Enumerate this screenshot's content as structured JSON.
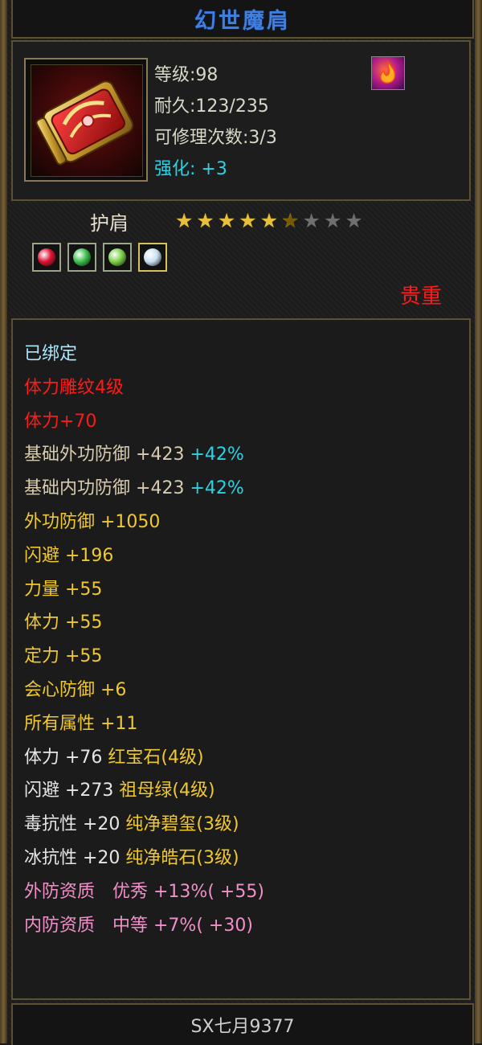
{
  "item": {
    "name": "幻世魔肩",
    "level": "等级:98",
    "durability": "耐久:123/235",
    "repair_count": "可修理次数:3/3",
    "enhance_label": "强化:",
    "enhance_value": "+3"
  },
  "equip": {
    "slot": "护肩",
    "stars_total": 9,
    "stars_filled": 5.5,
    "gems": [
      {
        "icon": "ruby-gem-icon",
        "color": "#e01030"
      },
      {
        "icon": "emerald-gem-icon",
        "color": "#3bc04a"
      },
      {
        "icon": "emerald-gem-icon",
        "color": "#7ad046"
      },
      {
        "icon": "diamond-gem-icon",
        "color": "#c8e0f0"
      }
    ],
    "quality": "贵重"
  },
  "attributes": {
    "bound": "已绑定",
    "carve_name": "体力雕纹4级",
    "carve_bonus": "体力+70",
    "base_ext_def_label": "基础外功防御",
    "base_ext_def_value": "+423",
    "base_ext_def_pct": "+42%",
    "base_int_def_label": "基础内功防御",
    "base_int_def_value": "+423",
    "base_int_def_pct": "+42%",
    "ext_def": "外功防御 +1050",
    "dodge": "闪避 +196",
    "strength": "力量 +55",
    "stamina": "体力 +55",
    "focus": "定力 +55",
    "crit_def": "会心防御 +6",
    "all_attr": "所有属性 +11",
    "gem1_stat": "体力 +76",
    "gem1_name": "红宝石(4级)",
    "gem2_stat": "闪避 +273",
    "gem2_name": "祖母绿(4级)",
    "gem3_stat": "毒抗性 +20",
    "gem3_name": "纯净碧玺(3级)",
    "gem4_stat": "冰抗性 +20",
    "gem4_name": "纯净皓石(3级)",
    "ext_aptitude": "外防资质　优秀 +13%( +55)",
    "int_aptitude": "内防资质　中等 +7%( +30)"
  },
  "owner": "SX七月9377",
  "colors": {
    "title": "#3f7fe0",
    "quality": "#ff1a1a",
    "gold_text": "#f0c830",
    "cyan_text": "#27d4e6",
    "pink_text": "#f090c8",
    "red_text": "#ff1a1a"
  }
}
